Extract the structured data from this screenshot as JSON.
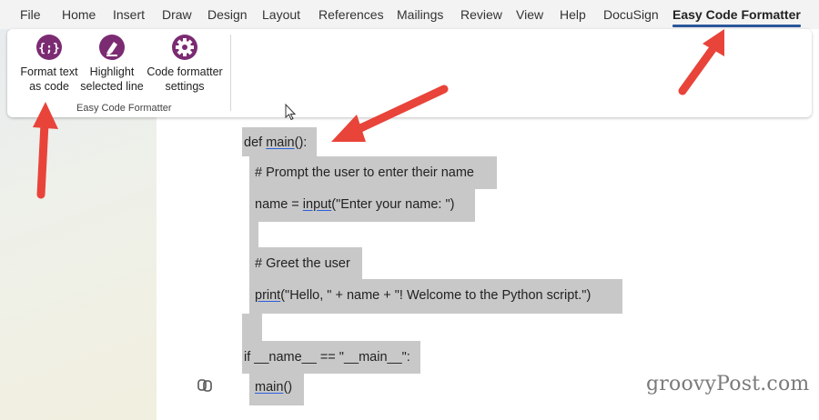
{
  "menu": {
    "tabs": [
      {
        "label": "File"
      },
      {
        "label": "Home"
      },
      {
        "label": "Insert"
      },
      {
        "label": "Draw"
      },
      {
        "label": "Design"
      },
      {
        "label": "Layout"
      },
      {
        "label": "References"
      },
      {
        "label": "Mailings"
      },
      {
        "label": "Review"
      },
      {
        "label": "View"
      },
      {
        "label": "Help"
      },
      {
        "label": "DocuSign"
      },
      {
        "label": "Easy Code Formatter"
      }
    ],
    "active_tab": "Easy Code Formatter"
  },
  "ribbon": {
    "buttons": [
      {
        "label_line1": "Format text",
        "label_line2": "as code",
        "icon": "code-braces-icon"
      },
      {
        "label_line1": "Highlight",
        "label_line2": "selected line",
        "icon": "highlighter-icon"
      },
      {
        "label_line1": "Code formatter",
        "label_line2": "settings",
        "icon": "gear-icon"
      }
    ],
    "group_label": "Easy Code Formatter",
    "icon_color": "#7b2b72"
  },
  "document": {
    "lines": [
      {
        "pre": "def ",
        "fn": "main",
        "post": "():"
      },
      {
        "text": "# Prompt the user to enter their name"
      },
      {
        "pre": "name = ",
        "fn": "input",
        "post": "(\"Enter your name: \")"
      },
      {
        "text": ""
      },
      {
        "text": "# Greet the user"
      },
      {
        "pre": "",
        "fn": "print",
        "post": "(\"Hello, \" + name + \"! Welcome to the Python script.\")"
      },
      {
        "text": ""
      },
      {
        "text": "if __name__ == \"__main__\":"
      },
      {
        "pre": "",
        "fn": "main",
        "post": "()"
      }
    ],
    "highlight_color": "#c8c8c8"
  },
  "annotations": {
    "arrow_color": "#e8443a"
  },
  "watermark": "groovyPost.com"
}
